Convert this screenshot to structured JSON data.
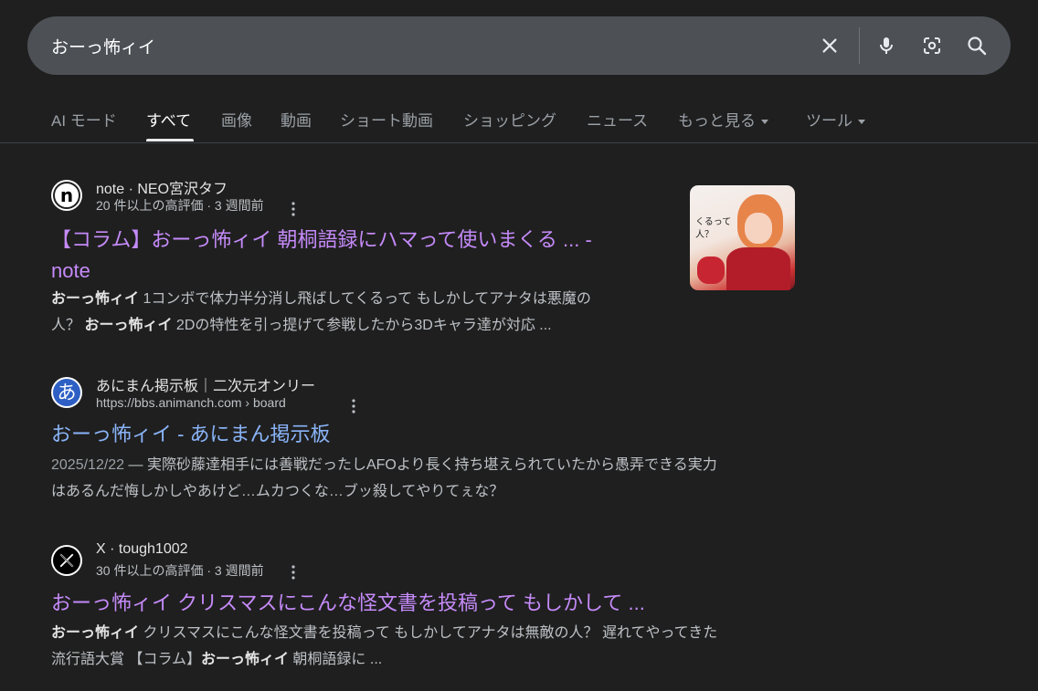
{
  "search": {
    "query": "おーっ怖ィイ"
  },
  "icons": {
    "clear": "close-icon",
    "mic": "microphone-icon",
    "lens": "google-lens-icon",
    "search": "search-icon"
  },
  "tabs": [
    {
      "label": "AI モード"
    },
    {
      "label": "すべて"
    },
    {
      "label": "画像"
    },
    {
      "label": "動画"
    },
    {
      "label": "ショート動画"
    },
    {
      "label": "ショッピング"
    },
    {
      "label": "ニュース"
    },
    {
      "label": "もっと見る"
    },
    {
      "label": "ツール"
    }
  ],
  "results": [
    {
      "site": "note · NEO宮沢タフ",
      "meta": "20 件以上の高評価 · 3 週間前",
      "title_line1": "【コラム】おーっ怖ィイ 朝桐語録にハマって使いまくる ... -",
      "title_line2": "note",
      "snippet_line1_bold": "おーっ怖ィイ",
      "snippet_line1_rest": " 1コンボで体力半分消し飛ばしてくるって もしかしてアナタは悪魔の",
      "snippet_line2_pre": "人？ ",
      "snippet_line2_bold": "おーっ怖ィイ",
      "snippet_line2_rest": " 2Dの特性を引っ提げて参戦したから3Dキャラ達が対応 ...",
      "thumb_text": "くるって 人？",
      "favicon_letter": "n"
    },
    {
      "site": "あにまん掲示板｜二次元オンリー",
      "url": "https://bbs.animanch.com › board",
      "title": "おーっ怖ィイ - あにまん掲示板",
      "date": "2025/12/22",
      "snippet_line1": " — 実際砂藤達相手には善戦だったしAFOより長く持ち堪えられていたから愚弄できる実力",
      "snippet_line2": "はあるんだ悔しかしやあけど…ムカつくな…ブッ殺してやりてぇな？",
      "favicon_letter": "あ"
    },
    {
      "site": "X · tough1002",
      "meta": "30 件以上の高評価 · 3 週間前",
      "title": "おーっ怖ィイ クリスマスにこんな怪文書を投稿って もしかして ...",
      "snippet_line1_bold": "おーっ怖ィイ",
      "snippet_line1_rest": " クリスマスにこんな怪文書を投稿って もしかしてアナタは無敵の人？ 遅れてやってきた",
      "snippet_line2_pre": "流行語大賞 【コラム】",
      "snippet_line2_bold": "おーっ怖ィイ",
      "snippet_line2_rest": " 朝桐語録に ..."
    }
  ],
  "colors": {
    "background": "#1f1f1f",
    "searchbar": "#4d5156",
    "visited_link": "#c58af9",
    "link": "#8ab4f8"
  }
}
